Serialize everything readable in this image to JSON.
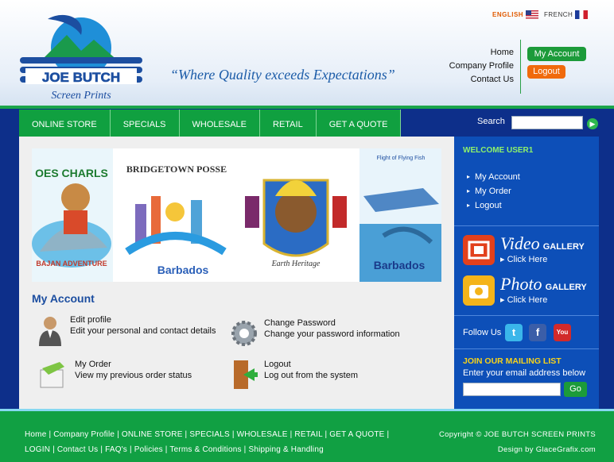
{
  "header": {
    "logo_text_1": "JOE BUTCH",
    "logo_text_2": "Screen Prints",
    "tagline": "“Where Quality exceeds Expectations”",
    "lang_english": "ENGLISH",
    "lang_french": "FRENCH",
    "links": [
      "Home",
      "Company Profile",
      "Contact Us"
    ],
    "my_account_button": "My Account",
    "logout_button": "Logout"
  },
  "nav": {
    "items": [
      "ONLINE STORE",
      "SPECIALS",
      "WHOLESALE",
      "RETAIL",
      "GET A QUOTE"
    ],
    "search_label": "Search",
    "search_value": "",
    "search_go_icon": "arrow-right-icon"
  },
  "banner": {
    "panels": [
      {
        "title": "OES CHARLS",
        "caption": "BAJAN ADVENTURE"
      },
      {
        "title": "BRIDGETOWN POSSE",
        "caption": "Barbados"
      },
      {
        "title": "",
        "caption": "Earth Heritage"
      },
      {
        "title": "Flight of Flying Fish",
        "caption": "Barbados"
      }
    ]
  },
  "account": {
    "heading": "My Account",
    "items": [
      {
        "title": "Edit profile",
        "desc": "Edit your personal and contact details",
        "icon": "person-icon"
      },
      {
        "title": "Change Password",
        "desc": "Change your password information",
        "icon": "gear-icon"
      },
      {
        "title": "My Order",
        "desc": "View my previous order status",
        "icon": "order-hand-icon"
      },
      {
        "title": "Logout",
        "desc": "Log out from the system",
        "icon": "door-exit-icon"
      }
    ]
  },
  "sidebar": {
    "welcome": "WELCOME USER1",
    "links": [
      "My Account",
      "My Order",
      "Logout"
    ],
    "video": {
      "big": "Video",
      "small": "GALLERY",
      "click": "Click Here"
    },
    "photo": {
      "big": "Photo",
      "small": "GALLERY",
      "click": "Click Here"
    },
    "follow": "Follow Us",
    "join": "JOIN OUR MAILING LIST",
    "enter": "Enter your email address below",
    "email_value": "",
    "go": "Go"
  },
  "footer": {
    "line1": "Home | Company Profile | ONLINE STORE | SPECIALS | WHOLESALE | RETAIL | GET A QUOTE |",
    "line2": "LOGIN | Contact Us | FAQ's | Policies | Terms & Conditions | Shipping & Handling",
    "copyright": "Copyright © JOE BUTCH SCREEN PRINTS",
    "design": "Design by GlaceGrafix.com"
  },
  "colors": {
    "green": "#10a040",
    "blue": "#0d4fb8",
    "orange": "#f06a0c",
    "dark_blue": "#0d2f8a"
  }
}
